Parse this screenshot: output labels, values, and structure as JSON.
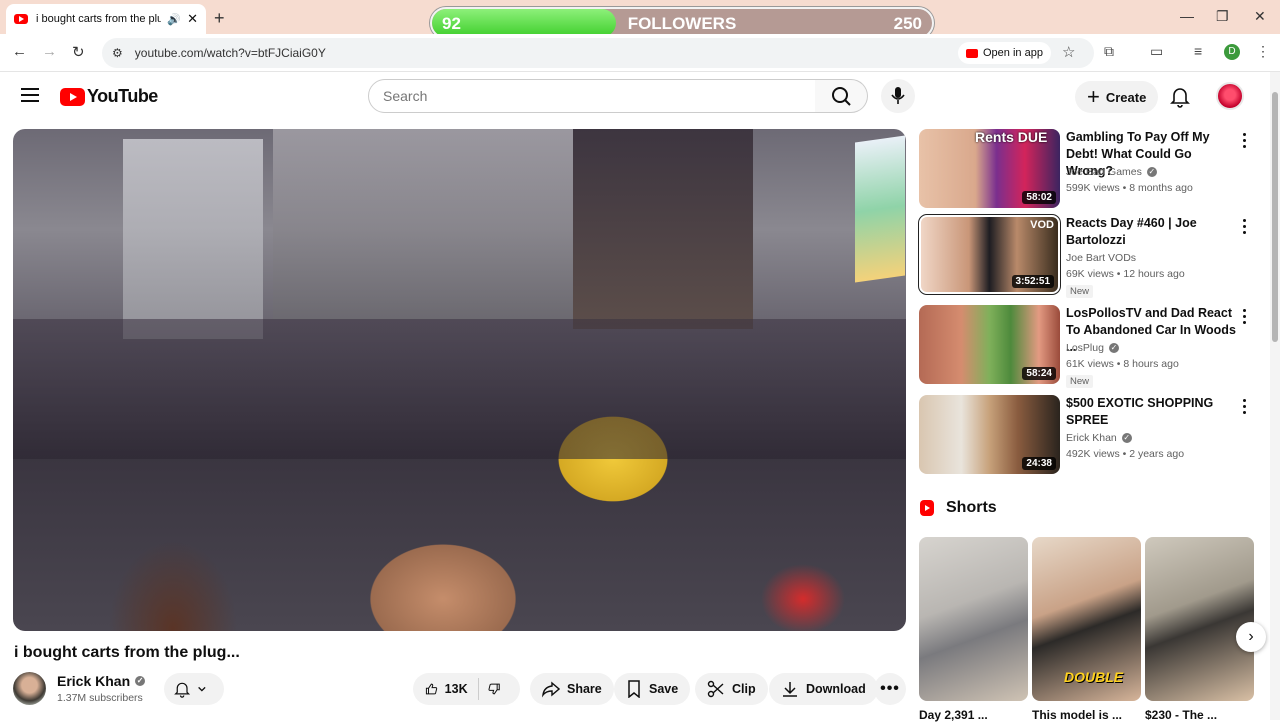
{
  "browser": {
    "tab_title": "i bought carts from the plu",
    "url": "youtube.com/watch?v=btFJCiaiG0Y",
    "open_in_app": "Open in app",
    "profile_initial": "D"
  },
  "overlay": {
    "current": "92",
    "label": "FOLLOWERS",
    "goal": "250",
    "progress_fraction": 0.368
  },
  "header": {
    "logo": "YouTube",
    "search_placeholder": "Search",
    "create_label": "Create"
  },
  "video": {
    "title": "i bought carts from the plug...",
    "channel": "Erick Khan",
    "subscribers": "1.37M subscribers",
    "likes": "13K",
    "share": "Share",
    "save": "Save",
    "clip": "Clip",
    "download": "Download"
  },
  "sidebar": {
    "recommendations": [
      {
        "title": "Gambling To Pay Off My Debt! What Could Go Wrong?",
        "channel": "Joe Bart Games",
        "meta": "599K views • 8 months ago",
        "duration": "58:02",
        "thumb_text": "Rents DUE",
        "is_new": false
      },
      {
        "title": "Reacts Day #460 | Joe Bartolozzi",
        "channel": "Joe Bart VODs",
        "meta": "69K views • 12 hours ago",
        "duration": "3:52:51",
        "thumb_text": "VOD",
        "is_new": true
      },
      {
        "title": "LosPollosTV and Dad React To Abandoned Car In Woods ...",
        "channel": "LosPlug",
        "meta": "61K views • 8 hours ago",
        "duration": "58:24",
        "thumb_text": "",
        "is_new": true
      },
      {
        "title": "$500 EXOTIC SHOPPING SPREE",
        "channel": "Erick Khan",
        "meta": "492K views • 2 years ago",
        "duration": "24:38",
        "thumb_text": "",
        "is_new": false
      }
    ],
    "new_badge": "New",
    "shorts_heading": "Shorts",
    "shorts": [
      {
        "title": "Day 2,391 ..."
      },
      {
        "title": "This model is ...",
        "overlay_text": "DOUBLE"
      },
      {
        "title": "$230 - The ..."
      }
    ]
  }
}
